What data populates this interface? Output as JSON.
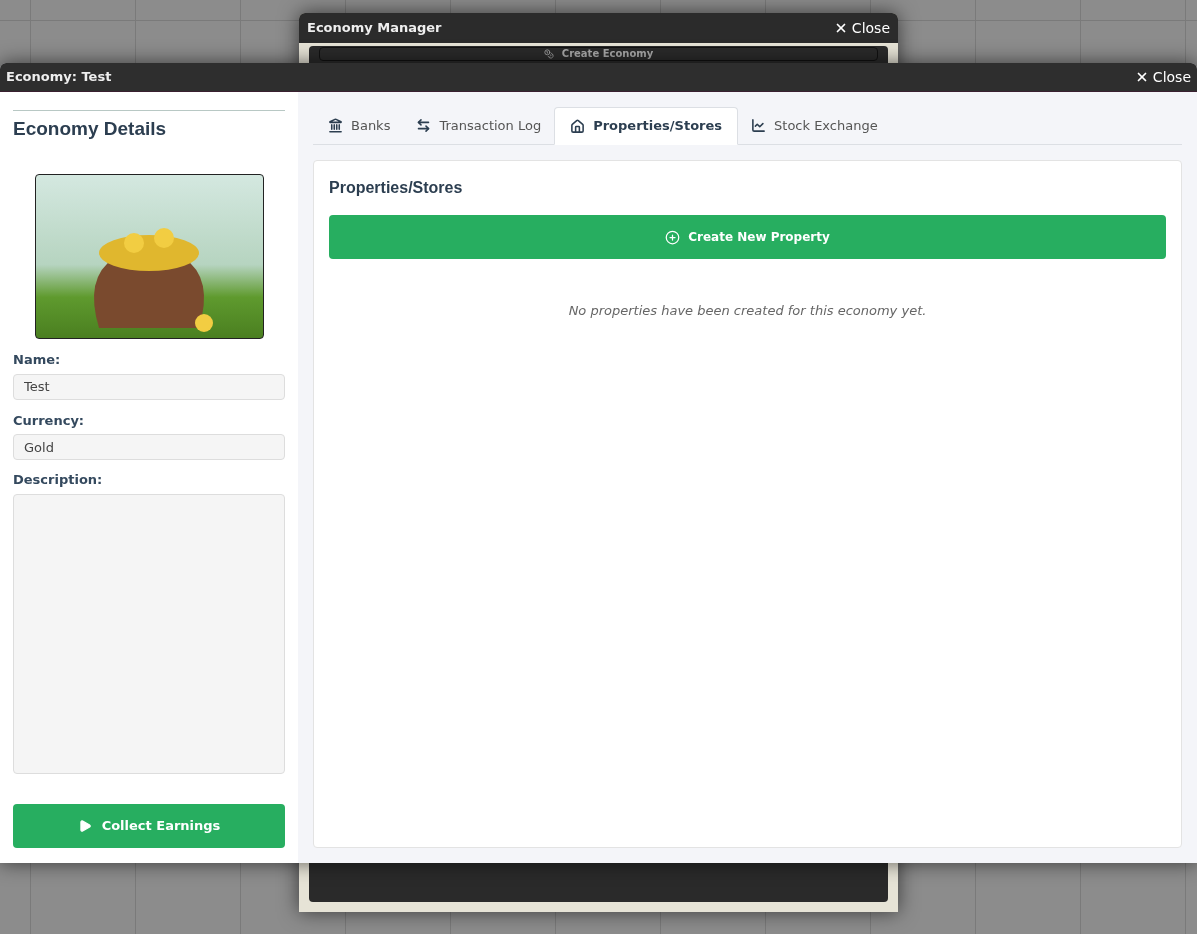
{
  "back_window": {
    "title": "Economy Manager",
    "close": "Close",
    "create_button": "Create Economy"
  },
  "window": {
    "title": "Economy: Test",
    "close": "Close"
  },
  "sidebar": {
    "heading": "Economy Details",
    "fields": [
      {
        "label": "Name:",
        "value": "Test",
        "kind": "input"
      },
      {
        "label": "Currency:",
        "value": "Gold",
        "kind": "input"
      },
      {
        "label": "Description:",
        "kind": "textarea"
      }
    ],
    "action": "Collect Earnings"
  },
  "tabs": [
    {
      "label": "Banks",
      "selected": false
    },
    {
      "label": "Transaction Log",
      "selected": false
    },
    {
      "label": "Properties/Stores",
      "selected": true
    },
    {
      "label": "Stock Exchange",
      "selected": false
    }
  ],
  "panel": {
    "heading": "Properties/Stores",
    "create_button": "Create New Property",
    "empty_message": "No properties have been created for this economy yet."
  }
}
